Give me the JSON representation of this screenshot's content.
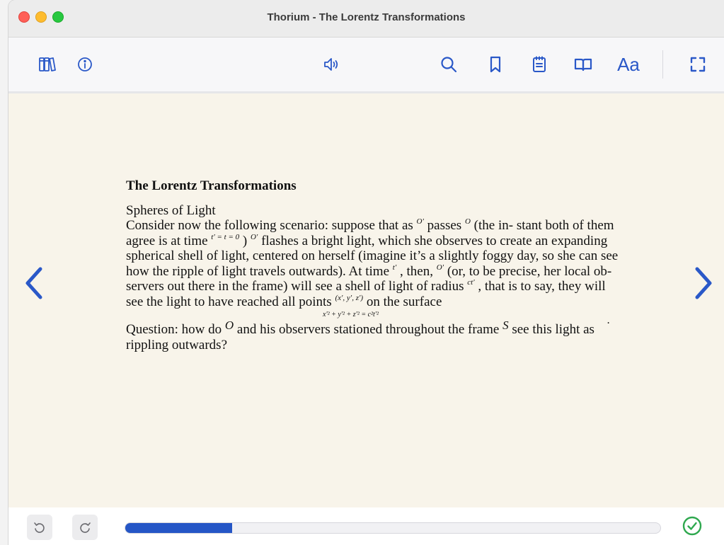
{
  "window": {
    "title": "Thorium - The Lorentz Transformations"
  },
  "toolbar": {
    "left": [
      {
        "name": "library-button",
        "icon": "books-icon"
      },
      {
        "name": "info-button",
        "icon": "info-icon"
      }
    ],
    "center": [
      {
        "name": "read-aloud-button",
        "icon": "speaker-icon"
      }
    ],
    "right": [
      {
        "name": "search-button",
        "icon": "search-icon"
      },
      {
        "name": "bookmark-button",
        "icon": "bookmark-icon"
      },
      {
        "name": "annotations-button",
        "icon": "notes-icon"
      },
      {
        "name": "toc-button",
        "icon": "open-book-icon"
      },
      {
        "name": "text-settings-button",
        "icon": "aa-icon",
        "label": "Aa"
      },
      {
        "name": "fullscreen-button",
        "icon": "fullscreen-icon"
      }
    ]
  },
  "content": {
    "chapter_title": "The Lorentz Transformations",
    "section_title": "Spheres of Light",
    "paragraph": {
      "s1": "Consider now the following scenario: suppose that as",
      "m1": "O′",
      "s2": "passes",
      "m2": "O",
      "s3": "(the in- stant both of them agree is at time",
      "m3": "t′ = t = 0",
      "s4": ")",
      "m4": "O′",
      "s5": "flashes a bright light, which she observes to create an expanding spherical shell of light, centered on herself (imagine it’s a slightly foggy day, so she can see how the ripple of light travels outwards). At time",
      "m5": "t′",
      "s6": ", then,",
      "m6": "O′",
      "s7": "(or, to be precise, her local ob- servers out there in the frame) will see a shell of light of radius",
      "m7": "ct′",
      "s8": ", that is to say, they will see the light to have reached all points",
      "m8": "(x′, y′, z′)",
      "s9": "on the surface"
    },
    "equation": "x′² + y′² + z′² = c²t′²",
    "equation_end": ".",
    "question": {
      "q1": "Question: how do",
      "qm1": "O",
      "q2": "and his observers stationed throughout the frame",
      "qm2": "S",
      "q3": "see this light as rippling outwards?"
    }
  },
  "navigation": {
    "prev_icon": "chevron-left-icon",
    "next_icon": "chevron-right-icon"
  },
  "footer": {
    "back_icon": "undo-icon",
    "forward_icon": "redo-icon",
    "progress_fraction": 0.2,
    "status_icon": "check-circle-icon"
  },
  "colors": {
    "accent": "#2a58c8",
    "page_background": "#f8f4ea",
    "progress": "#2556c6",
    "success": "#2fa84f"
  }
}
